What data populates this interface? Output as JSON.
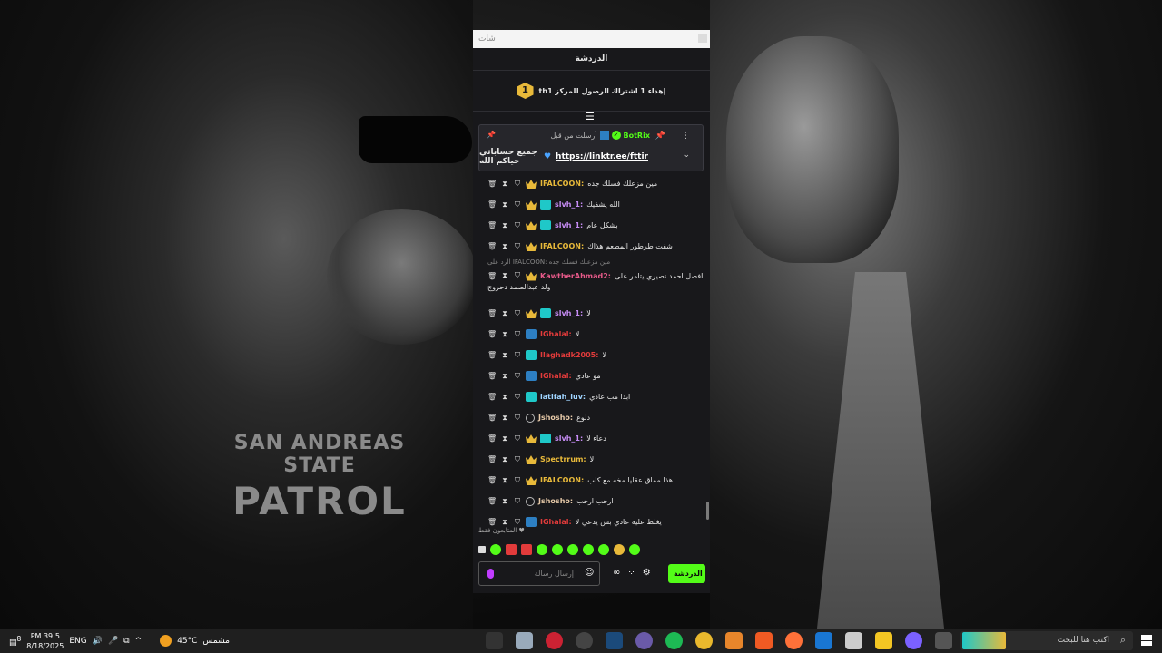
{
  "chat": {
    "search_placeholder": "شات",
    "title": "الدردشة",
    "goal_badge": "1",
    "goal_text": "thإهداء 1 اشتراك الرصول للمركز 1",
    "pinned": {
      "author": "BotRix",
      "posted_by": "أرسلت من قبل",
      "link": "https://linktr.ee/fttir",
      "text": "جميع حساباتي حياكم الله"
    },
    "messages": [
      {
        "user": "IFALCOON:",
        "text": "مين مزعلك فسلك جده",
        "color": "#e8b93a",
        "badges": [
          "crown"
        ]
      },
      {
        "user": "slvh_1:",
        "text": "الله يشفيك",
        "color": "#c68cf5",
        "badges": [
          "crown",
          "teal"
        ]
      },
      {
        "user": "slvh_1:",
        "text": "بشكل عام",
        "color": "#c68cf5",
        "badges": [
          "crown",
          "teal"
        ]
      },
      {
        "user": "IFALCOON:",
        "text": "شفت طرطور المطعم هذاك",
        "color": "#e8b93a",
        "badges": [
          "crown"
        ]
      }
    ],
    "reply_note": "الرد على IFALCOON: مين مزعلك فسلك جده",
    "reply_message": {
      "user": "KawtherAhmad2:",
      "text": "افصل احمد نصيري يتامر على",
      "text2": "ولد عبدالصمد دحروج",
      "color": "#e85a8a"
    },
    "messages2": [
      {
        "user": "slvh_1:",
        "text": "لا",
        "color": "#c68cf5",
        "badges": [
          "crown",
          "teal"
        ]
      },
      {
        "user": "IGhalal:",
        "text": "لا",
        "color": "#e23b3b",
        "badges": [
          "blue"
        ]
      },
      {
        "user": "Ilaghadk2005:",
        "text": "لا",
        "color": "#e23b3b",
        "badges": [
          "teal"
        ]
      },
      {
        "user": "IGhalal:",
        "text": "مو عادي",
        "color": "#e23b3b",
        "badges": [
          "blue"
        ]
      },
      {
        "user": "latifah_luv:",
        "text": "ابدا مب عادي",
        "color": "#9fd4ff",
        "badges": [
          "teal"
        ]
      },
      {
        "user": "Jshosho:",
        "text": "دلوع",
        "color": "#e6c9a8",
        "badges": [
          "ring"
        ]
      },
      {
        "user": "slvh_1:",
        "text": "دعاء لا",
        "color": "#c68cf5",
        "badges": [
          "crown",
          "teal"
        ]
      },
      {
        "user": "Spectrrum:",
        "text": "لا",
        "color": "#e8b93a",
        "badges": [
          "crown"
        ]
      },
      {
        "user": "IFALCOON:",
        "text": "هذا مماق عقليا مخه مع كلب",
        "color": "#e8b93a",
        "badges": [
          "crown"
        ]
      },
      {
        "user": "Jshosho:",
        "text": "ارحب ارحب",
        "color": "#e6c9a8",
        "badges": [
          "ring"
        ]
      },
      {
        "user": "IGhalal:",
        "text": "يغلط عليه عادي بس يدعي لا",
        "color": "#e23b3b",
        "badges": [
          "blue"
        ]
      }
    ],
    "followers_only": "المتابعون فقط",
    "input_placeholder": "إرسال رسالة",
    "send_label": "الدردشة"
  },
  "wallpaper": {
    "line1": "SAN ANDREAS STATE",
    "line2": "PATROL"
  },
  "taskbar": {
    "time": "PM 39:5",
    "date": "8/18/2025",
    "lang": "ENG",
    "temp": "45°C",
    "weather": "مشمس",
    "search_placeholder": "اكتب هنا للبحث",
    "notif_count": "8"
  }
}
